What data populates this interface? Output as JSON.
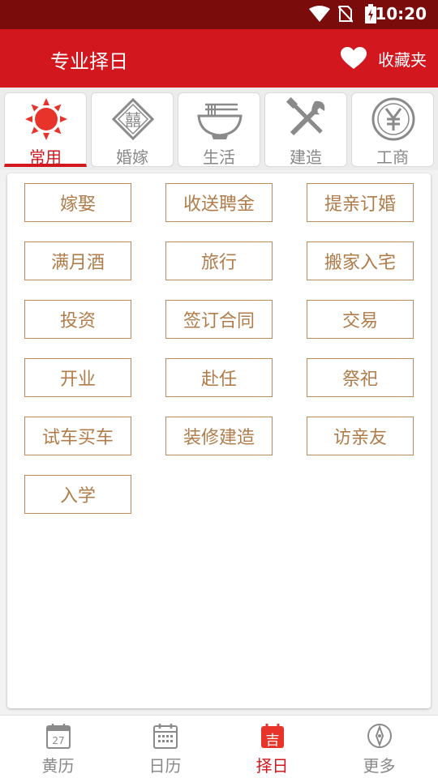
{
  "status_bar": {
    "time": "10:20"
  },
  "app_bar": {
    "title": "专业择日",
    "favorites_label": "收藏夹"
  },
  "categories": [
    {
      "label": "常用",
      "icon": "sun-icon",
      "active": true
    },
    {
      "label": "婚嫁",
      "icon": "double-happiness-icon",
      "active": false
    },
    {
      "label": "生活",
      "icon": "noodle-bowl-icon",
      "active": false
    },
    {
      "label": "建造",
      "icon": "tools-icon",
      "active": false
    },
    {
      "label": "工商",
      "icon": "yen-coin-icon",
      "active": false
    }
  ],
  "activities": [
    "嫁娶",
    "收送聘金",
    "提亲订婚",
    "满月酒",
    "旅行",
    "搬家入宅",
    "投资",
    "签订合同",
    "交易",
    "开业",
    "赴任",
    "祭祀",
    "试车买车",
    "装修建造",
    "访亲友",
    "入学"
  ],
  "tabs": [
    {
      "label": "黄历",
      "icon": "calendar-day-icon",
      "calendar_day": "27",
      "active": false
    },
    {
      "label": "日历",
      "icon": "calendar-grid-icon",
      "active": false
    },
    {
      "label": "择日",
      "icon": "auspicious-calendar-icon",
      "glyph": "吉",
      "active": true
    },
    {
      "label": "更多",
      "icon": "compass-icon",
      "active": false
    }
  ],
  "colors": {
    "primary": "#d2171f",
    "status_bar": "#7b0c0c",
    "item_text": "#b07c4a",
    "item_border": "#b68b5e"
  }
}
